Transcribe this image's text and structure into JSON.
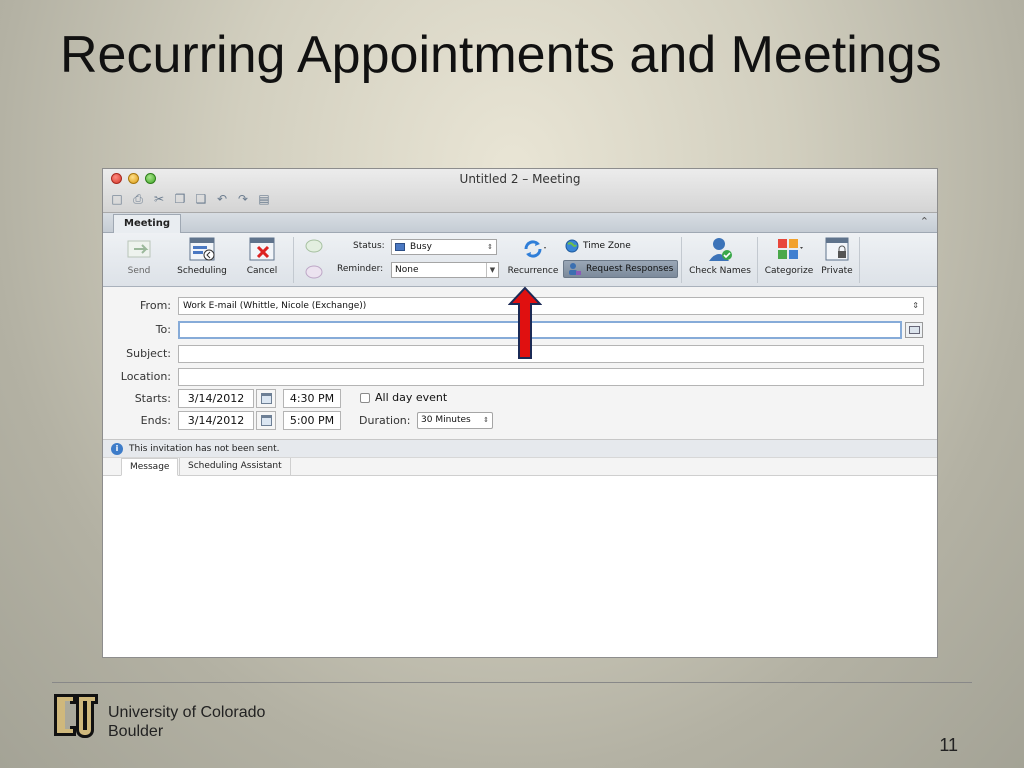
{
  "slide": {
    "title": "Recurring Appointments and Meetings",
    "page_number": "11"
  },
  "window": {
    "title": "Untitled 2 – Meeting",
    "controls": [
      "close-icon",
      "minimize-icon",
      "maximize-icon"
    ]
  },
  "quick_access": [
    "save-icon",
    "print-icon",
    "cut-icon",
    "copy-icon",
    "paste-icon",
    "undo-icon",
    "redo-icon",
    "note-icon"
  ],
  "ribbon": {
    "tab": "Meeting",
    "send": "Send",
    "scheduling": "Scheduling",
    "cancel": "Cancel",
    "status_label": "Status:",
    "status_value": "Busy",
    "reminder_label": "Reminder:",
    "reminder_value": "None",
    "recurrence": "Recurrence",
    "time_zone": "Time Zone",
    "request_responses": "Request Responses",
    "check_names": "Check Names",
    "categorize": "Categorize",
    "private": "Private"
  },
  "form": {
    "from_label": "From:",
    "from_value": "Work E-mail (Whittle, Nicole (Exchange))",
    "to_label": "To:",
    "to_value": "",
    "subject_label": "Subject:",
    "subject_value": "",
    "location_label": "Location:",
    "location_value": "",
    "starts_label": "Starts:",
    "start_date": "3/14/2012",
    "start_time": "4:30 PM",
    "all_day_label": "All day event",
    "ends_label": "Ends:",
    "end_date": "3/14/2012",
    "end_time": "5:00 PM",
    "duration_label": "Duration:",
    "duration_value": "30 Minutes"
  },
  "info_bar": {
    "message": "This invitation has not been sent."
  },
  "subtabs": {
    "message": "Message",
    "scheduling_assistant": "Scheduling Assistant"
  },
  "footer": {
    "university_line1": "University of Colorado",
    "university_line2": "Boulder"
  },
  "colors": {
    "annotation_arrow": "#e01010",
    "focus_border": "#86abd8"
  }
}
